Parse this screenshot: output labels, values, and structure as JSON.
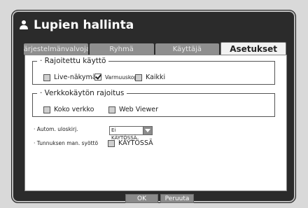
{
  "window": {
    "title": "Lupien hallinta",
    "title_icon": "person-icon"
  },
  "tabs": [
    {
      "label": "Järjestelmänvalvoja",
      "active": false
    },
    {
      "label": "Ryhmä",
      "active": false
    },
    {
      "label": "Käyttäjä",
      "active": false
    },
    {
      "label": "Asetukset",
      "active": true
    }
  ],
  "restricted_access": {
    "legend": "· Rajoitettu käyttö",
    "options": [
      {
        "label": "Live-näkymä",
        "checked": false
      },
      {
        "label": "Varmuuskopio",
        "checked": true
      },
      {
        "label": "Kaikki",
        "checked": false
      }
    ]
  },
  "network_restriction": {
    "legend": "· Verkkokäytön rajoitus",
    "options": [
      {
        "label": "Koko verkko",
        "checked": false
      },
      {
        "label": "Web Viewer",
        "checked": false
      }
    ]
  },
  "auto_logout": {
    "label": "· Autom. uloskirj.",
    "value": "Ei KÄYTÖSSÄ"
  },
  "manual_id_entry": {
    "label": "· Tunnuksen man. syöttö",
    "option_label": "KÄYTÖSSÄ",
    "checked": false
  },
  "buttons": {
    "ok": "OK",
    "cancel": "Peruuta"
  }
}
